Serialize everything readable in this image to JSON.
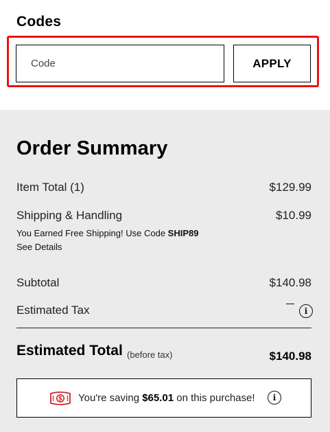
{
  "codes": {
    "title": "Codes",
    "input_placeholder": "Code",
    "input_value": "",
    "apply_label": "APPLY",
    "highlight_color": "#ee1111"
  },
  "summary": {
    "title": "Order Summary",
    "item_total_label": "Item Total (1)",
    "item_total_value": "$129.99",
    "shipping_label": "Shipping & Handling",
    "shipping_value": "$10.99",
    "promo_prefix": "You Earned Free Shipping! Use Code ",
    "promo_code": "SHIP89",
    "see_details": "See Details",
    "subtotal_label": "Subtotal",
    "subtotal_value": "$140.98",
    "tax_label": "Estimated Tax",
    "info_icon": "i",
    "total_label": "Estimated Total",
    "total_note": "(before tax)",
    "total_value": "$140.98",
    "background_color": "#ebebeb"
  },
  "savings": {
    "icon": "money-icon",
    "prefix": "You're saving ",
    "amount": "$65.01",
    "suffix": " on this purchase!",
    "accent_color": "#d2232a"
  }
}
